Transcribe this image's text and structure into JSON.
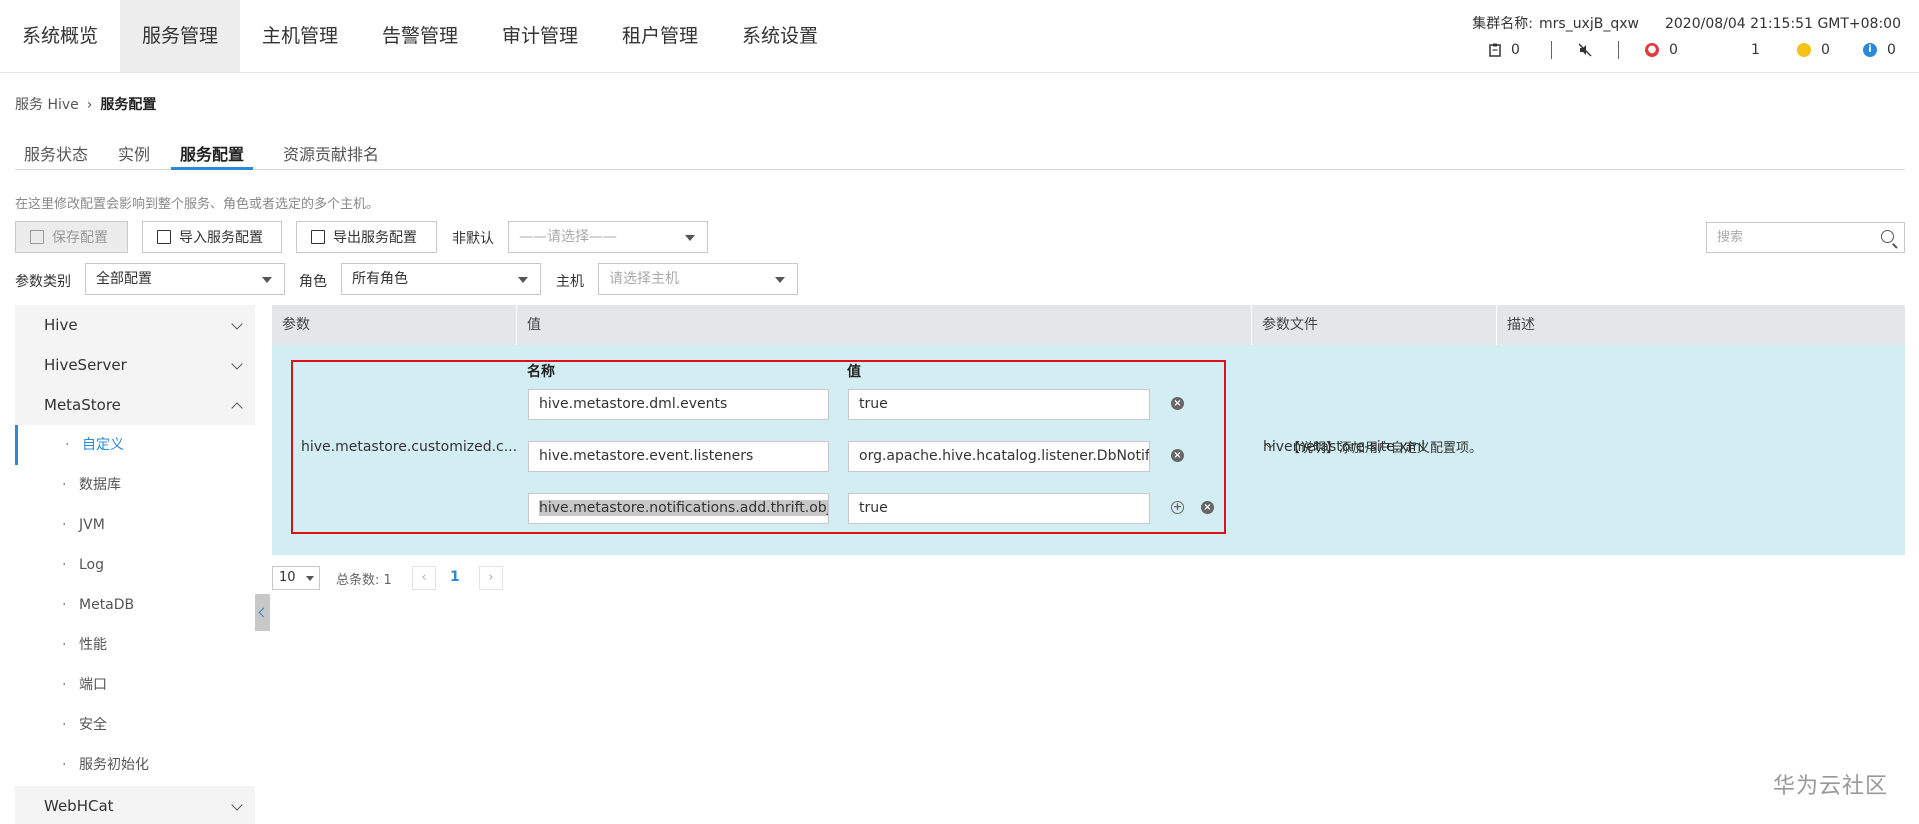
{
  "nav": {
    "tabs": [
      "系统概览",
      "服务管理",
      "主机管理",
      "告警管理",
      "审计管理",
      "租户管理",
      "系统设置"
    ],
    "active_tab": "服务管理",
    "cluster_label": "集群名称:",
    "cluster_name": "mrs_uxjB_qxw",
    "datetime": "2020/08/04 21:15:51 GMT+08:00",
    "alarms": {
      "tasks": "0",
      "critical": "0",
      "major": "1",
      "minor": "0",
      "info": "0"
    },
    "colors": {
      "critical": "#e0393e",
      "minor": "#f4c21b",
      "info": "#2a8ad8"
    }
  },
  "breadcrumb": {
    "parent": "服务 Hive",
    "current": "服务配置"
  },
  "subtabs": [
    "服务状态",
    "实例",
    "服务配置",
    "资源贡献排名"
  ],
  "active_subtab": "服务配置",
  "hint": "在这里修改配置会影响到整个服务、角色或者选定的多个主机。",
  "toolbar": {
    "save": "保存配置",
    "import": "导入服务配置",
    "export": "导出服务配置",
    "non_default_label": "非默认",
    "non_default_placeholder": "——请选择——",
    "search_placeholder": "搜索"
  },
  "filters": {
    "category_label": "参数类别",
    "category_value": "全部配置",
    "role_label": "角色",
    "role_value": "所有角色",
    "host_label": "主机",
    "host_placeholder": "请选择主机"
  },
  "sidebar": {
    "groups": [
      "Hive",
      "HiveServer",
      "MetaStore",
      "WebHCat"
    ],
    "metastore_items": [
      "自定义",
      "数据库",
      "JVM",
      "Log",
      "MetaDB",
      "性能",
      "端口",
      "安全",
      "服务初始化"
    ],
    "active_item": "自定义"
  },
  "table": {
    "headers": [
      "参数",
      "值",
      "参数文件",
      "描述"
    ],
    "row": {
      "param": "hive.metastore.customized.c...",
      "name_header": "名称",
      "value_header": "值",
      "pairs": [
        {
          "name": "hive.metastore.dml.events",
          "value": "true"
        },
        {
          "name": "hive.metastore.event.listeners",
          "value": "org.apache.hive.hcatalog.listener.DbNotifi"
        },
        {
          "name": "hive.metastore.notifications.add.thrift.obje",
          "value": "true"
        }
      ],
      "file": "hivemetastore-site.xml",
      "description": "【说明】添加用户自定义配置项。"
    }
  },
  "pager": {
    "page_size": "10",
    "total": "总条数: 1",
    "current_page": "1"
  },
  "watermark": "华为云社区"
}
